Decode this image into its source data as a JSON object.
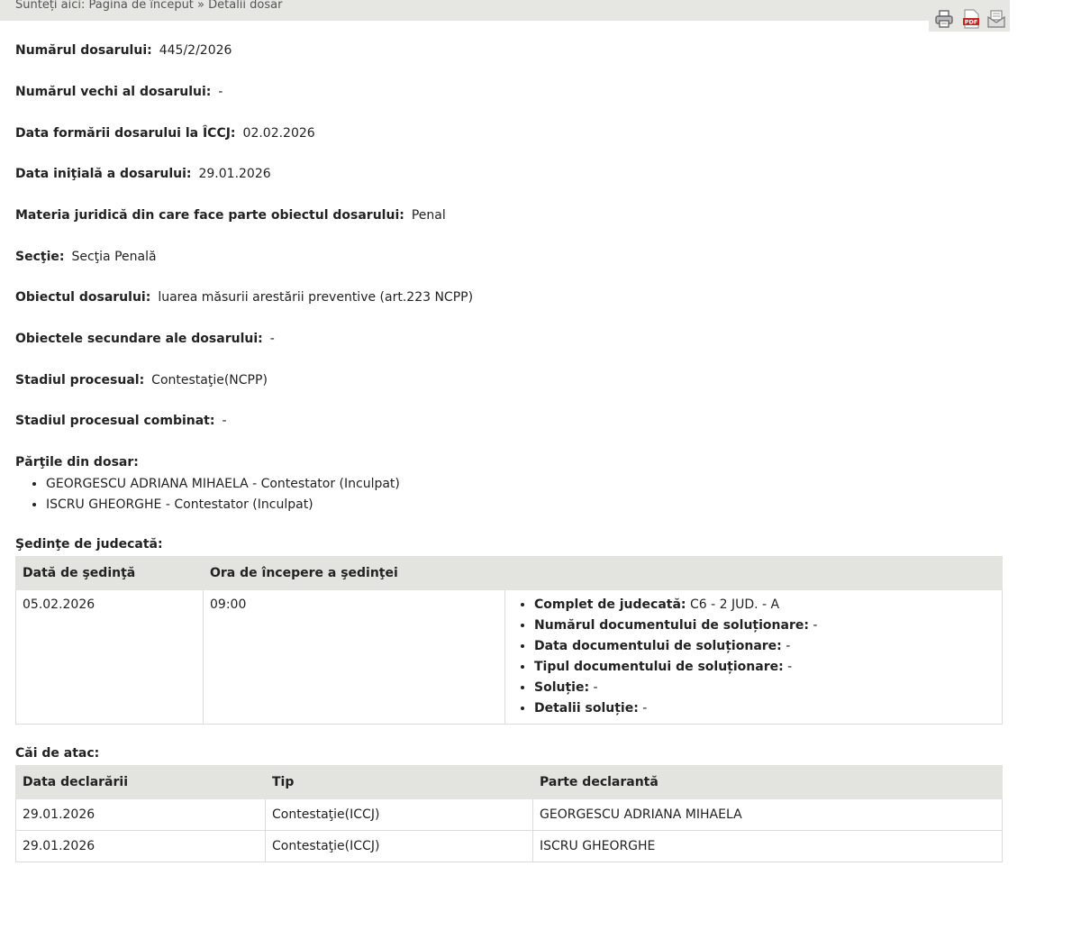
{
  "breadcrumb": "Sunteți aici: Pagina de început » Detalii dosar",
  "toolbar": {
    "print_icon": "printer-icon",
    "pdf_icon": "pdf-icon",
    "email_icon": "email-icon",
    "pdf_text": "PDF"
  },
  "fields": {
    "numar_label": "Numărul dosarului:",
    "numar_value": "445/2/2026",
    "numar_vechi_label": "Numărul vechi al dosarului:",
    "numar_vechi_value": "-",
    "data_formarii_label": "Data formării dosarului la ÎCCJ:",
    "data_formarii_value": "02.02.2026",
    "data_initiala_label": "Data iniţială a dosarului:",
    "data_initiala_value": "29.01.2026",
    "materia_label": "Materia juridică din care face parte obiectul dosarului:",
    "materia_value": "Penal",
    "sectie_label": "Secţie:",
    "sectie_value": "Secţia Penală",
    "obiect_label": "Obiectul dosarului:",
    "obiect_value": "luarea măsurii arestării preventive (art.223 NCPP)",
    "obiecte_sec_label": "Obiectele secundare ale dosarului:",
    "obiecte_sec_value": "-",
    "stadiu_label": "Stadiul procesual:",
    "stadiu_value": "Contestaţie(NCPP)",
    "stadiu_comb_label": "Stadiul procesual combinat:",
    "stadiu_comb_value": "-"
  },
  "parties": {
    "title": "Părţile din dosar:",
    "items": [
      "GEORGESCU ADRIANA MIHAELA - Contestator (Inculpat)",
      "ISCRU GHEORGHE - Contestator (Inculpat)"
    ]
  },
  "sessions": {
    "title": "Şedinţe de judecată:",
    "headers": [
      "Dată de şedinţă",
      "Ora de începere a şedinţei",
      ""
    ],
    "rows": [
      {
        "date": "05.02.2026",
        "time": "09:00",
        "details": [
          {
            "label": "Complet de judecată:",
            "value": "C6 - 2 JUD. - A"
          },
          {
            "label": "Numărul documentului de soluționare:",
            "value": "-"
          },
          {
            "label": "Data documentului de soluționare:",
            "value": "-"
          },
          {
            "label": "Tipul documentului de soluționare:",
            "value": "-"
          },
          {
            "label": "Soluție:",
            "value": "-"
          },
          {
            "label": "Detalii soluție:",
            "value": "-"
          }
        ]
      }
    ]
  },
  "appeals": {
    "title": "Căi de atac:",
    "headers": [
      "Data declarării",
      "Tip",
      "Parte declarantă"
    ],
    "rows": [
      [
        "29.01.2026",
        "Contestaţie(ICCJ)",
        "GEORGESCU ADRIANA MIHAELA"
      ],
      [
        "29.01.2026",
        "Contestaţie(ICCJ)",
        "ISCRU GHEORGHE"
      ]
    ]
  }
}
